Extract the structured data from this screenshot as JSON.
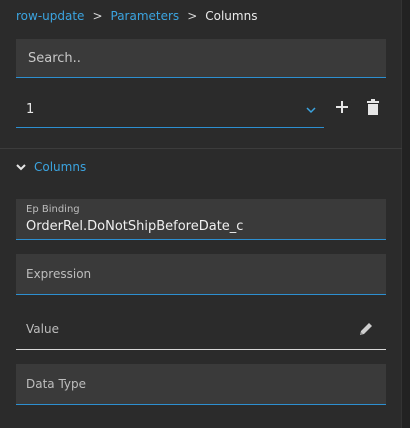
{
  "breadcrumb": {
    "items": [
      "row-update",
      "Parameters"
    ],
    "separator": ">",
    "current": "Columns"
  },
  "search": {
    "placeholder": "Search.."
  },
  "row_selector": {
    "value": "1",
    "icons": [
      "chevron-down-icon",
      "plus-icon",
      "trash-icon"
    ]
  },
  "section": {
    "title": "Columns",
    "expanded": true
  },
  "fields": {
    "ep_binding": {
      "label": "Ep Binding",
      "value": "OrderRel.DoNotShipBeforeDate_c"
    },
    "expression": {
      "placeholder": "Expression"
    },
    "value": {
      "placeholder": "Value",
      "icon": "pencil-icon"
    },
    "data_type": {
      "placeholder": "Data Type"
    }
  },
  "colors": {
    "background": "#2b2b2b",
    "field_background": "#3a3a3a",
    "accent": "#2d8fd0",
    "link": "#3ba4e0"
  }
}
